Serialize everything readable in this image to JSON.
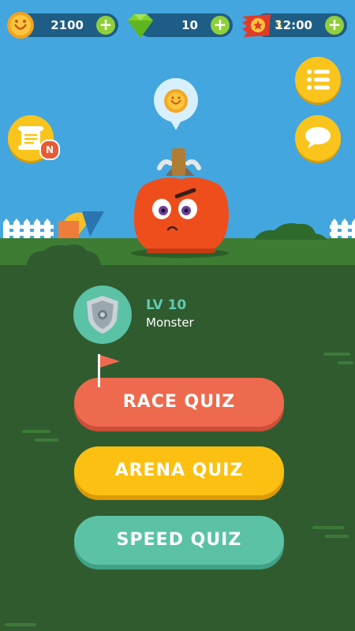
{
  "currencies": {
    "coins": "2100",
    "gems": "10",
    "tickets_count": "3",
    "timer": "12:00"
  },
  "player": {
    "level": "LV 10",
    "rank": "Monster"
  },
  "buttons": {
    "race": "RACE QUIZ",
    "arena": "ARENA QUIZ",
    "speed": "SPEED QUIZ"
  },
  "badges": {
    "new": "N"
  },
  "icons": {
    "menu": "list-icon",
    "chat": "chat-bubble-icon",
    "scroll": "scroll-icon",
    "coin": "coin-icon",
    "gem": "gem-icon",
    "ticket": "ticket-icon"
  },
  "colors": {
    "sky": "#43a6df",
    "grass": "#305b2f",
    "race": "#ee6a4e",
    "arena": "#fcc012",
    "speed": "#5bc2a6",
    "accent_green": "#8fcf3c"
  }
}
